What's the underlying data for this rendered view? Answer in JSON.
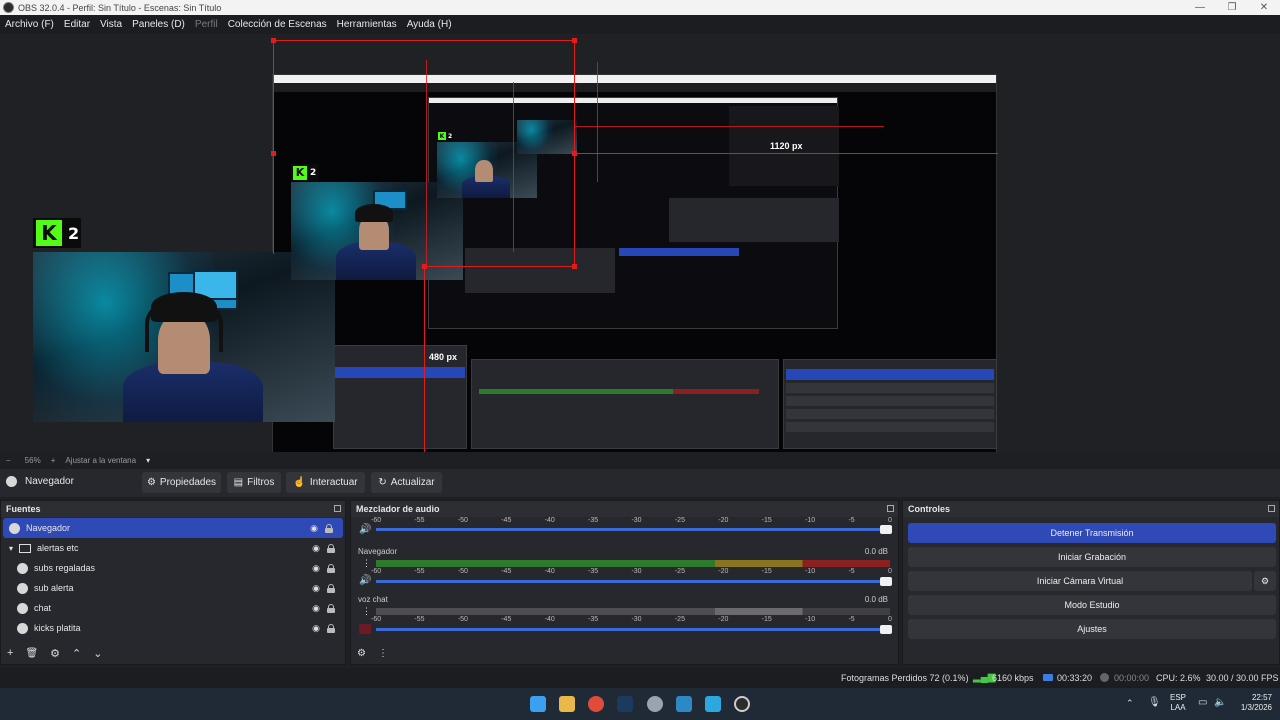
{
  "window": {
    "title": "OBS 32.0.4 - Perfil: Sin Título - Escenas: Sin Título"
  },
  "menu": [
    {
      "label": "Archivo (F)",
      "disabled": false
    },
    {
      "label": "Editar",
      "disabled": false
    },
    {
      "label": "Vista",
      "disabled": false
    },
    {
      "label": "Paneles (D)",
      "disabled": false
    },
    {
      "label": "Perfil",
      "disabled": true
    },
    {
      "label": "Colección de Escenas",
      "disabled": false
    },
    {
      "label": "Herramientas",
      "disabled": false
    },
    {
      "label": "Ayuda (H)",
      "disabled": false
    }
  ],
  "preview": {
    "label_1120": "1120 px",
    "label_480": "480 px",
    "kick_number": "2"
  },
  "zoom": {
    "minus": "−",
    "value": "56%",
    "plus": "+",
    "fit_label": "Ajustar a la ventana",
    "dropdown": "▾"
  },
  "source_toolbar": {
    "selected_source": "Navegador",
    "properties": "Propiedades",
    "filters": "Filtros",
    "interact": "Interactuar",
    "refresh": "Actualizar"
  },
  "sources": {
    "title": "Fuentes",
    "items": [
      {
        "name": "Navegador",
        "selected": true,
        "indent": 0,
        "type": "browser"
      },
      {
        "name": "alertas etc",
        "selected": false,
        "indent": 1,
        "type": "folder"
      },
      {
        "name": "subs regaladas",
        "selected": false,
        "indent": 2,
        "type": "browser"
      },
      {
        "name": "sub alerta",
        "selected": false,
        "indent": 2,
        "type": "browser"
      },
      {
        "name": "chat",
        "selected": false,
        "indent": 2,
        "type": "browser"
      },
      {
        "name": "kicks platita",
        "selected": false,
        "indent": 2,
        "type": "browser"
      }
    ],
    "footer": [
      "+",
      "🗑",
      "⚙",
      "⌃",
      "⌄"
    ]
  },
  "mixer": {
    "title": "Mezclador de audio",
    "ticks": [
      "-60",
      "-55",
      "-50",
      "-45",
      "-40",
      "-35",
      "-30",
      "-25",
      "-20",
      "-15",
      "-10",
      "-5",
      "0"
    ],
    "channels": [
      {
        "name": "Navegador",
        "db": "0.0 dB",
        "level": 1.0,
        "muted": false
      },
      {
        "name": "voz chat",
        "db": "0.0 dB",
        "level": 1.0,
        "muted": true
      }
    ]
  },
  "controls": {
    "title": "Controles",
    "buttons": [
      {
        "label": "Detener Transmisión",
        "active": true
      },
      {
        "label": "Iniciar Grabación",
        "active": false
      },
      {
        "label": "Iniciar Cámara Virtual",
        "active": false
      },
      {
        "label": "Modo Estudio",
        "active": false
      },
      {
        "label": "Ajustes",
        "active": false
      }
    ]
  },
  "status": {
    "dropped_frames": "Fotogramas Perdidos 72 (0.1%)",
    "bitrate": "6160 kbps",
    "stream_time": "00:33:20",
    "rec_time": "00:00:00",
    "cpu": "CPU: 2.6%",
    "fps": "30.00 / 30.00 FPS"
  },
  "taskbar": {
    "lang_top": "ESP",
    "lang_bottom": "LAA",
    "time": "22:57",
    "date": "1/3/2026"
  },
  "colors": {
    "accent": "#2f4ab7",
    "kick_green": "#53fc18",
    "guide_red": "#e21c1c",
    "meter_green": "#2d7a2d",
    "meter_yellow": "#8a7420",
    "meter_red": "#8a2020"
  }
}
